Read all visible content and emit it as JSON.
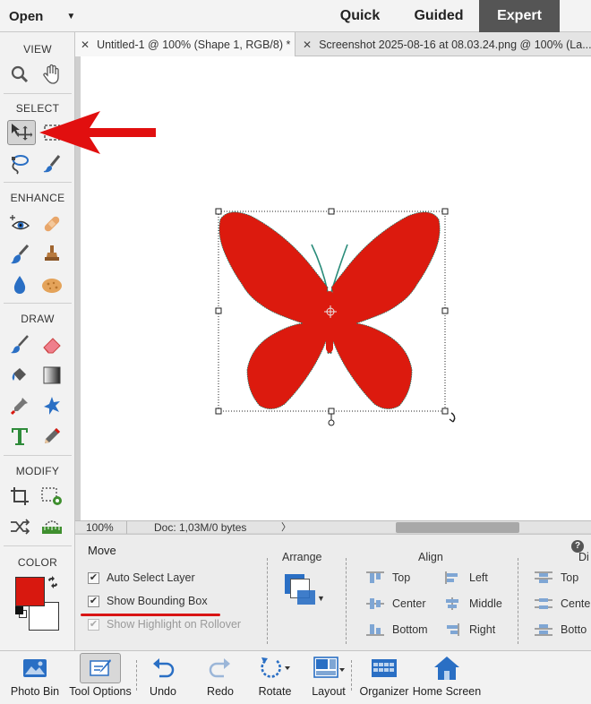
{
  "topbar": {
    "open_label": "Open",
    "modes": [
      "Quick",
      "Guided",
      "Expert"
    ],
    "active_mode": "Expert"
  },
  "toolbox": {
    "sections": {
      "view": "VIEW",
      "select": "SELECT",
      "enhance": "ENHANCE",
      "draw": "DRAW",
      "modify": "MODIFY",
      "color": "COLOR"
    },
    "tools": {
      "view": [
        "zoom-tool",
        "hand-tool"
      ],
      "select": [
        "move-tool",
        "marquee-tool",
        "lasso-tool",
        "quick-selection-tool"
      ],
      "enhance": [
        "red-eye-tool",
        "spot-healing-brush-tool",
        "smart-brush-tool",
        "clone-stamp-tool",
        "blur-tool",
        "sponge-tool"
      ],
      "draw": [
        "brush-tool",
        "eraser-tool",
        "paint-bucket-tool",
        "gradient-tool",
        "eyedropper-tool",
        "custom-shape-tool",
        "type-tool",
        "pencil-tool"
      ],
      "modify": [
        "crop-tool",
        "recompose-tool",
        "content-aware-move-tool",
        "straighten-tool"
      ]
    },
    "selected_tool": "move-tool",
    "foreground_color": "#d8180f",
    "background_color": "#ffffff"
  },
  "doc_tabs": [
    {
      "label": "Untitled-1 @ 100% (Shape 1, RGB/8) *",
      "active": true
    },
    {
      "label": "Screenshot 2025-08-16 at 08.03.24.png @ 100% (La...",
      "active": false
    }
  ],
  "canvas": {
    "shape_color": "#dc1a0e",
    "annotation_arrow_color": "#e10f0f"
  },
  "status": {
    "zoom": "100%",
    "doc_info": "Doc: 1,03M/0 bytes",
    "arrow": "〉"
  },
  "tool_options": {
    "title": "Move",
    "auto_select_layer": {
      "label": "Auto Select Layer",
      "checked": true
    },
    "show_bounding_box": {
      "label": "Show Bounding Box",
      "checked": true
    },
    "show_highlight": {
      "label": "Show Highlight on Rollover",
      "checked": true,
      "disabled": true
    },
    "arrange_label": "Arrange",
    "align_label": "Align",
    "distribute_label": "Di",
    "align_col1": [
      "Top",
      "Center",
      "Bottom"
    ],
    "align_col2": [
      "Left",
      "Middle",
      "Right"
    ],
    "distribute_col": [
      "Top",
      "Cente",
      "Botto"
    ],
    "help": "?"
  },
  "taskbar": {
    "buttons": [
      "Photo Bin",
      "Tool Options",
      "Undo",
      "Redo",
      "Rotate",
      "Layout",
      "Organizer",
      "Home Screen"
    ]
  }
}
